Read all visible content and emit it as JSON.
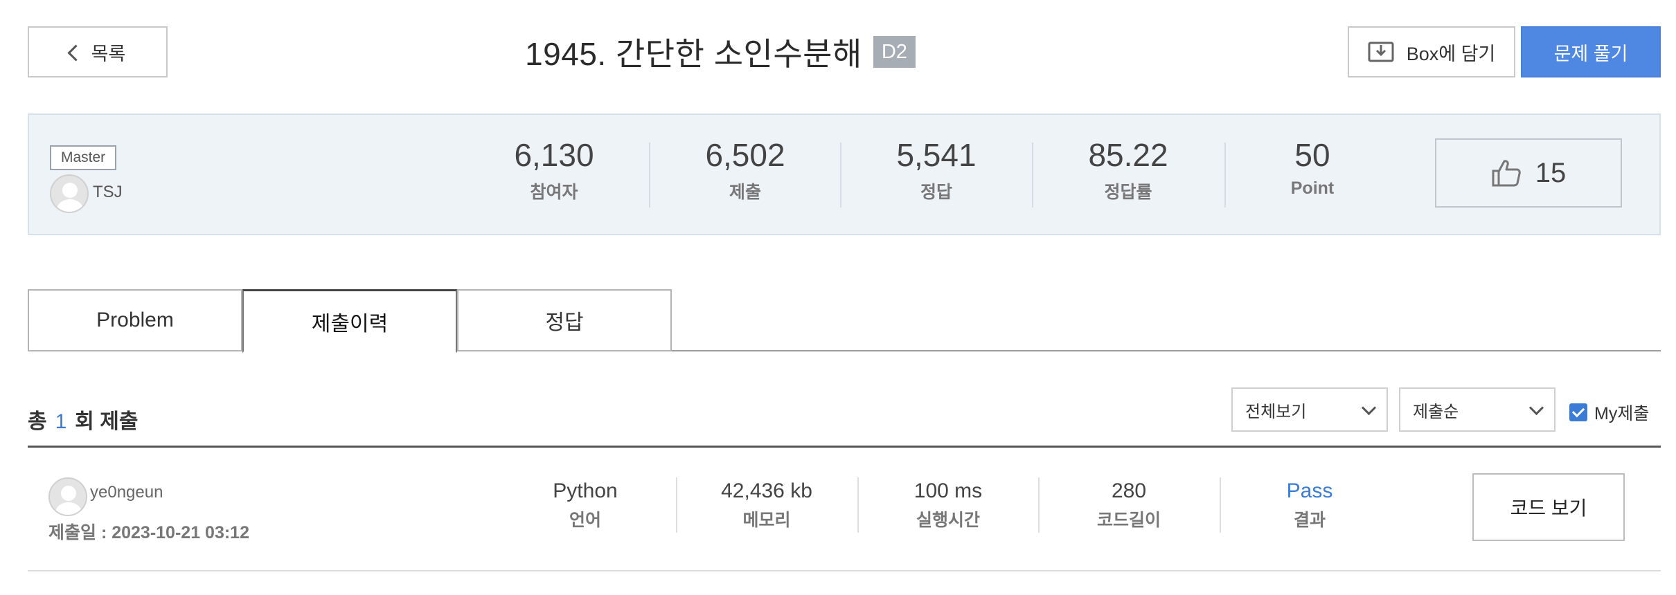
{
  "header": {
    "back_label": "목록",
    "title": "1945. 간단한 소인수분해",
    "difficulty": "D2",
    "box_label": "Box에 담기",
    "solve_label": "문제 풀기"
  },
  "problem": {
    "level": "Master",
    "author": "TSJ",
    "stats": [
      {
        "value": "6,130",
        "label": "참여자"
      },
      {
        "value": "6,502",
        "label": "제출"
      },
      {
        "value": "5,541",
        "label": "정답"
      },
      {
        "value": "85.22",
        "label": "정답률"
      },
      {
        "value": "50",
        "label": "Point"
      }
    ],
    "likes": "15"
  },
  "tabs": [
    {
      "label": "Problem",
      "active": false
    },
    {
      "label": "제출이력",
      "active": true
    },
    {
      "label": "정답",
      "active": false
    }
  ],
  "submissions": {
    "total_prefix": "총",
    "total_count": "1",
    "total_suffix": "회 제출",
    "filter_view": "전체보기",
    "filter_sort": "제출순",
    "my_label": "My제출",
    "my_checked": true,
    "rows": [
      {
        "user": "ye0ngeun",
        "date": "제출일 : 2023-10-21 03:12",
        "language": {
          "value": "Python",
          "label": "언어"
        },
        "memory": {
          "value": "42,436 kb",
          "label": "메모리"
        },
        "time": {
          "value": "100 ms",
          "label": "실행시간"
        },
        "length": {
          "value": "280",
          "label": "코드길이"
        },
        "result": {
          "value": "Pass",
          "label": "결과"
        },
        "code_label": "코드 보기"
      }
    ]
  },
  "colors": {
    "primary": "#4f88e2",
    "pass": "#3a7bd5",
    "panel_bg": "#eef3f8"
  }
}
